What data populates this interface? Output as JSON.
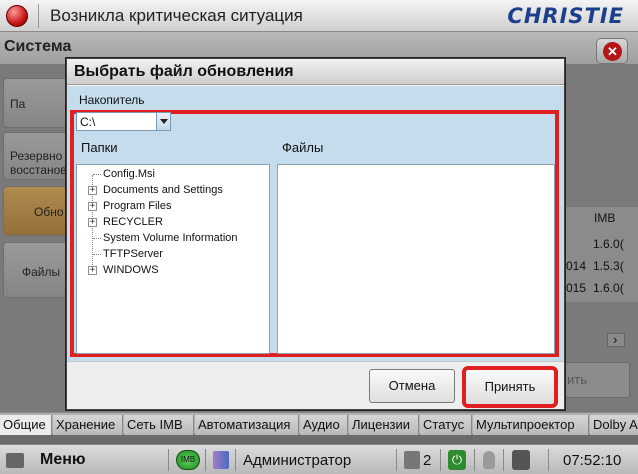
{
  "topbar": {
    "alarm_title": "Возникла критическая ситуация",
    "brand": "CHRISTIE"
  },
  "system": {
    "title": "Система",
    "close_glyph": "✕",
    "nav": [
      "Па",
      "Резервно восстанов",
      "Обно",
      "Файлы"
    ],
    "table_header": "IMB",
    "table_rows": [
      {
        "a": "",
        "b": "1.6.0("
      },
      {
        "a": "014",
        "b": "1.5.3("
      },
      {
        "a": "015",
        "b": "1.6.0("
      }
    ],
    "scroll_glyph": "›",
    "hidden_button": "ить"
  },
  "tabs": [
    "Общие",
    "Хранение",
    "Сеть IMB",
    "Автоматизация",
    "Аудио",
    "Лицензии",
    "Статус",
    "Мультипроектор",
    "Dolby A"
  ],
  "statusbar": {
    "menu": "Меню",
    "imb_badge": "IMB",
    "user": "Администратор",
    "doc_count": "2",
    "power_glyph": "⏻",
    "time": "07:52:10"
  },
  "dialog": {
    "title": "Выбрать файл обновления",
    "drive_label": "Накопитель",
    "drive_value": "C:\\",
    "folders_label": "Папки",
    "files_label": "Файлы",
    "folders": [
      {
        "name": "Config.Msi",
        "expandable": false
      },
      {
        "name": "Documents and Settings",
        "expandable": true
      },
      {
        "name": "Program Files",
        "expandable": true
      },
      {
        "name": "RECYCLER",
        "expandable": true
      },
      {
        "name": "System Volume Information",
        "expandable": false
      },
      {
        "name": "TFTPServer",
        "expandable": false
      },
      {
        "name": "WINDOWS",
        "expandable": true
      }
    ],
    "files": [],
    "expander_glyph": "+",
    "cancel_label": "Отмена",
    "accept_label": "Принять"
  },
  "colors": {
    "highlight": "#e02020",
    "panel_bg": "#c4dceb",
    "brand": "#1c3f8c",
    "alarm": "#c91414"
  }
}
